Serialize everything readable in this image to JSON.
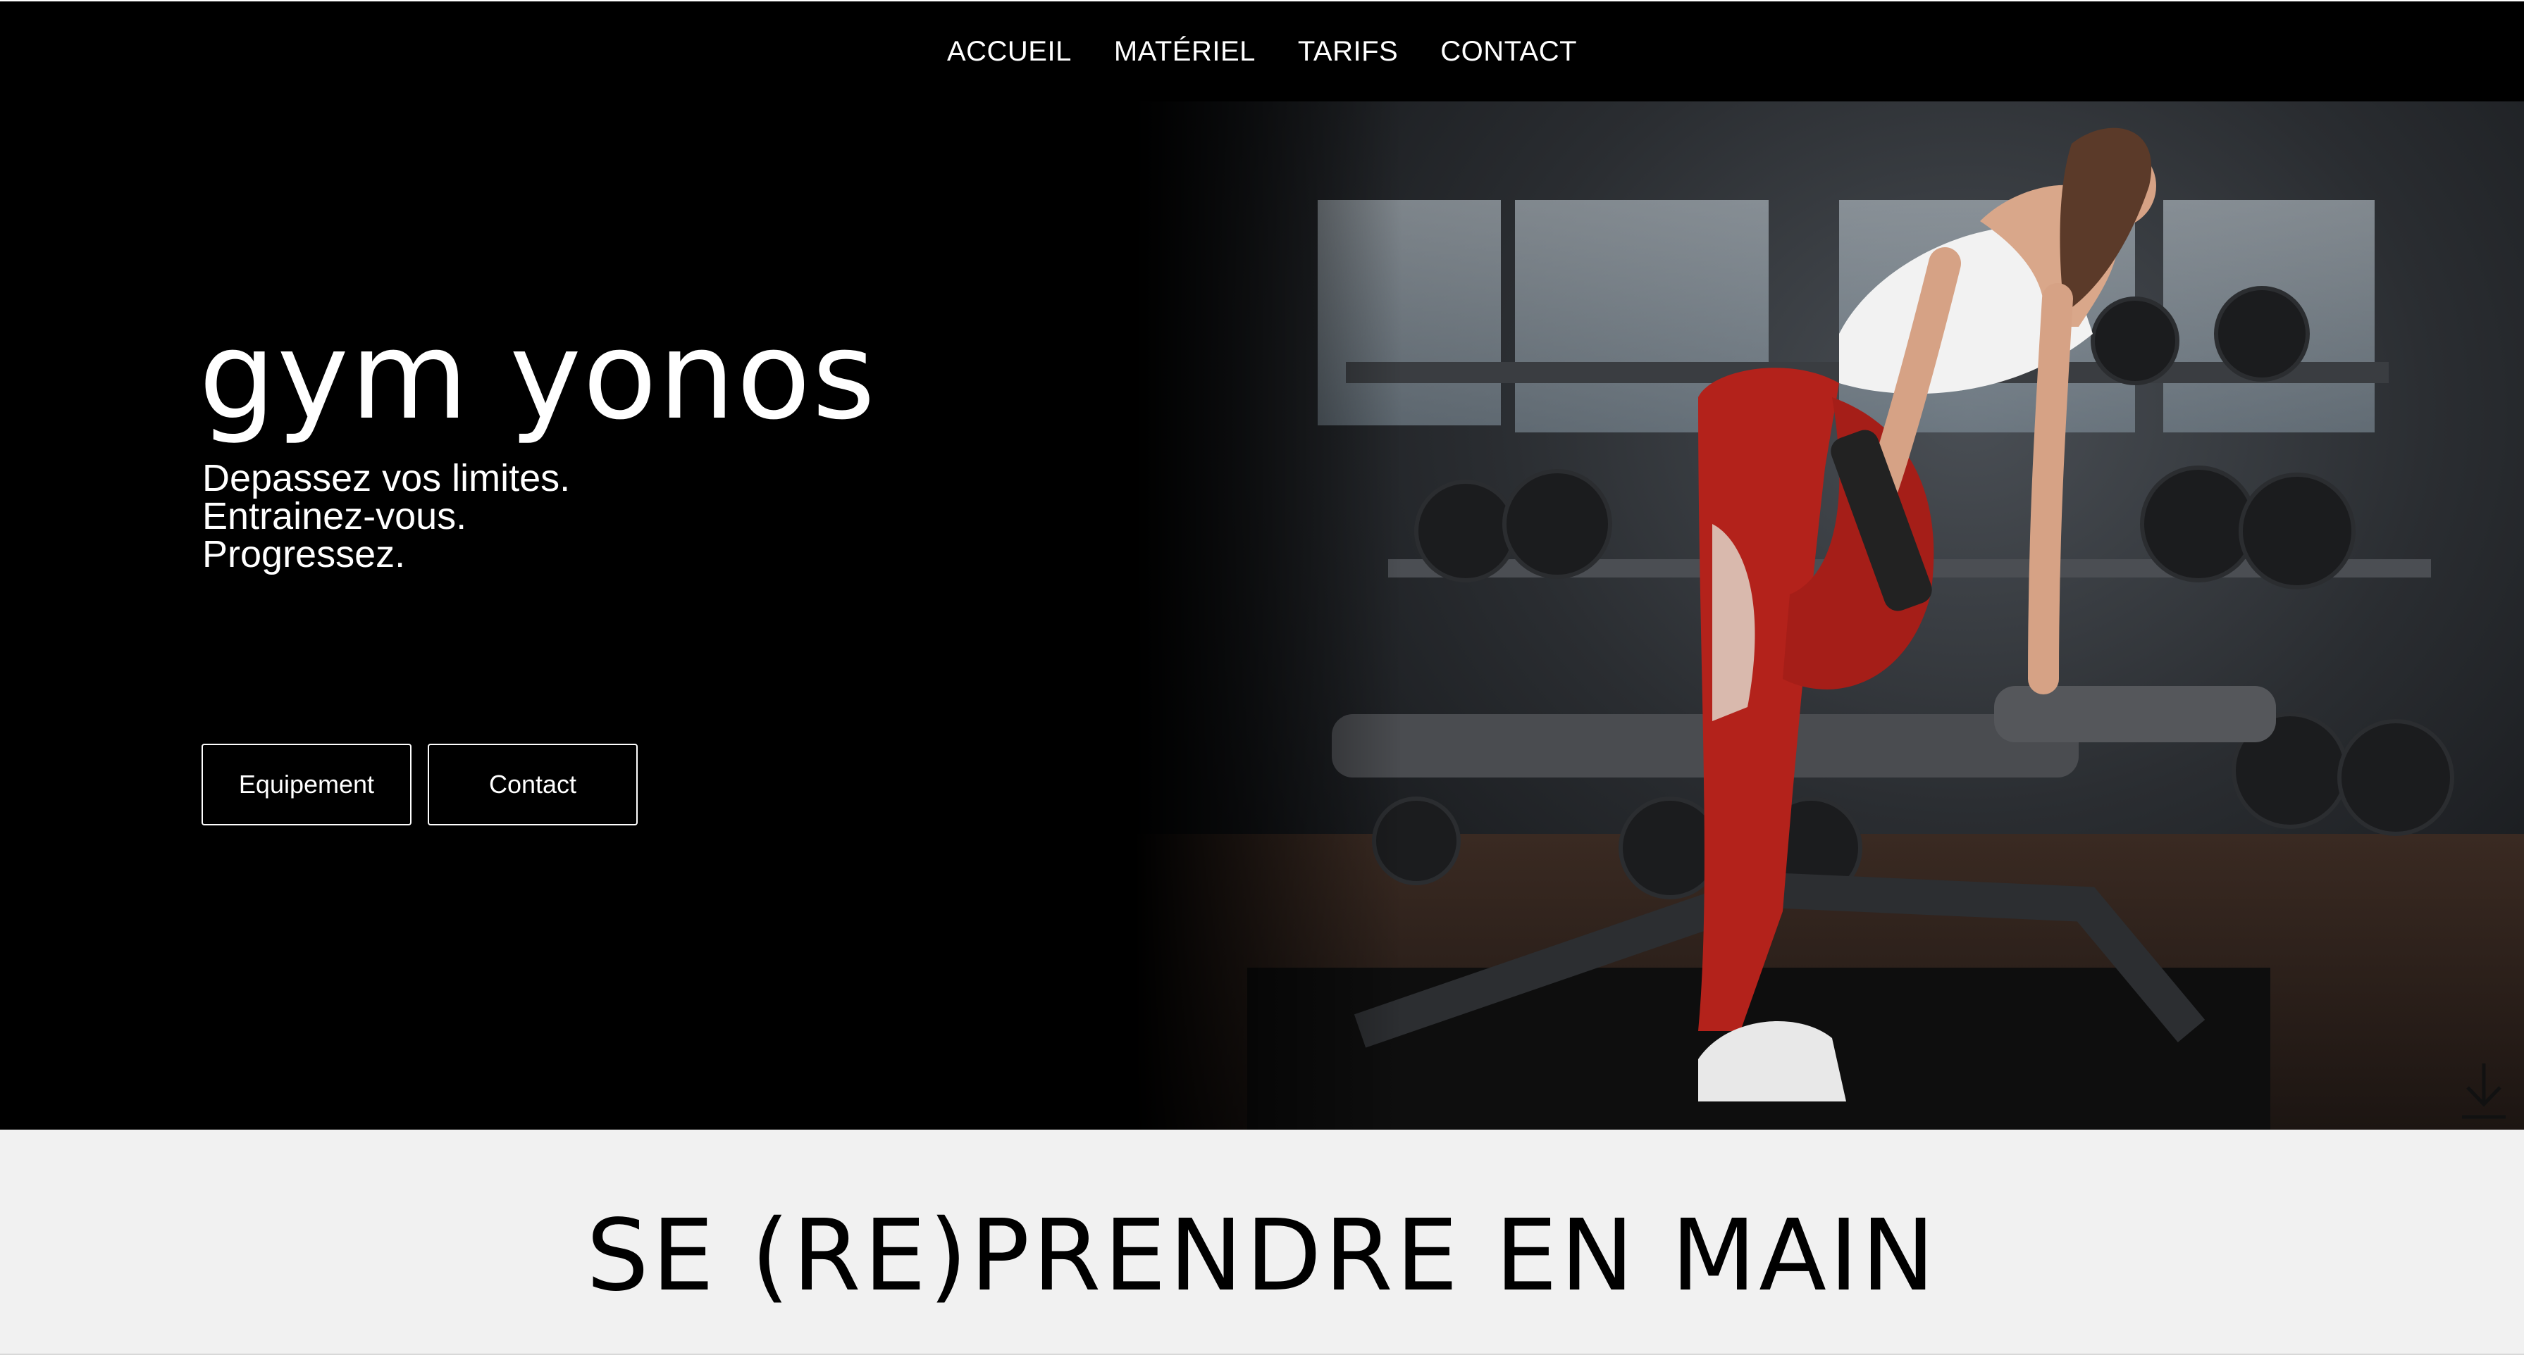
{
  "nav": {
    "items": [
      {
        "label": "ACCUEIL"
      },
      {
        "label": "MATÉRIEL"
      },
      {
        "label": "TARIFS"
      },
      {
        "label": "CONTACT"
      }
    ]
  },
  "hero": {
    "title": "gym yonos",
    "tagline": [
      "Depassez vos limites.",
      "Entrainez-vous.",
      "Progressez."
    ],
    "buttons": {
      "equipment": "Equipement",
      "contact": "Contact"
    },
    "scroll_icon": "download-arrow-icon"
  },
  "section": {
    "heading": "SE (RE)PRENDRE EN MAIN"
  },
  "colors": {
    "hero_background": "#000000",
    "section_background": "#f1f1f1",
    "text_light": "#ffffff",
    "text_dark": "#000000"
  }
}
